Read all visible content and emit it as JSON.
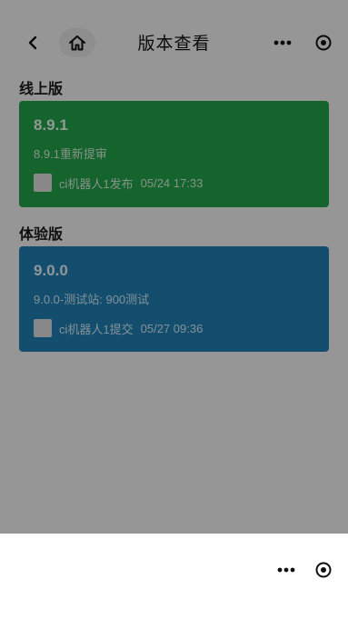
{
  "nav": {
    "title": "版本查看",
    "back_icon": "chevron-left-icon",
    "home_icon": "home-icon",
    "more_icon": "more-dots-icon",
    "close_icon": "target-circle-icon"
  },
  "sections": [
    {
      "title": "线上版",
      "card": {
        "version": "8.9.1",
        "description": "8.9.1重新提审",
        "author": "ci机器人1发布",
        "time": "05/24 17:33",
        "color": "#23a049"
      }
    },
    {
      "title": "体验版",
      "card": {
        "version": "9.0.0",
        "description": "9.0.0-测试站: 900测试",
        "author": "ci机器人1提交",
        "time": "05/27 09:36",
        "color": "#1f7fb3"
      }
    }
  ],
  "bottom_sheet": {
    "more_icon": "more-dots-icon",
    "close_icon": "target-circle-icon"
  }
}
